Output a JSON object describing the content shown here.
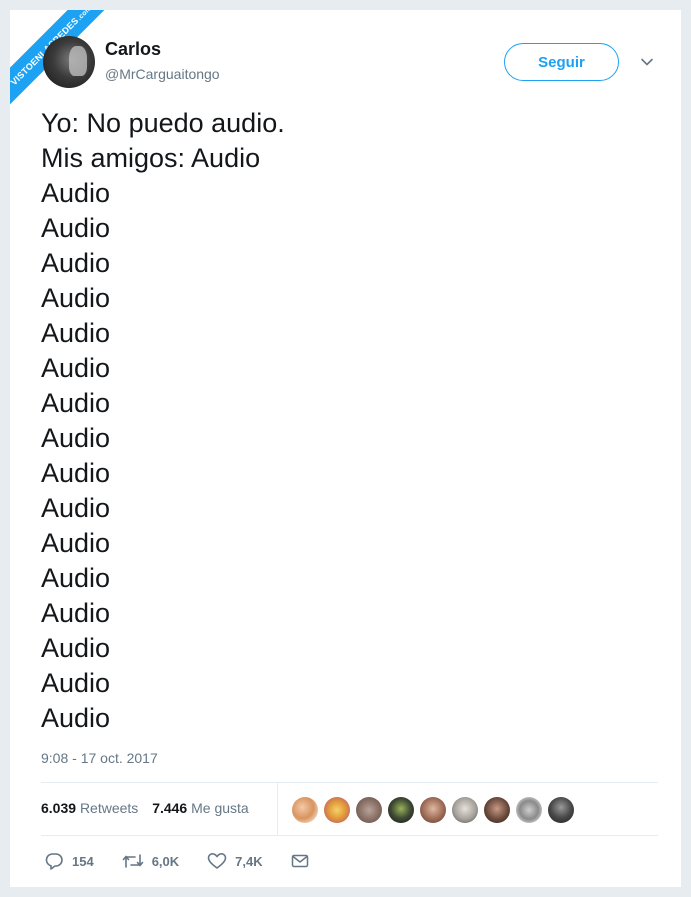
{
  "watermark": {
    "text": "VISTOENLASREDES",
    "suffix": ".com"
  },
  "user": {
    "name": "Carlos",
    "handle": "@MrCarguaitongo"
  },
  "follow_label": "Seguir",
  "tweet": {
    "lines": [
      "Yo: No puedo audio.",
      "Mis amigos: Audio",
      "Audio",
      "Audio",
      "Audio",
      "Audio",
      "Audio",
      "Audio",
      "Audio",
      "Audio",
      "Audio",
      "Audio",
      "Audio",
      "Audio",
      "Audio",
      "Audio",
      "Audio",
      "Audio"
    ]
  },
  "timestamp": "9:08 - 17 oct. 2017",
  "stats": {
    "retweets_count": "6.039",
    "retweets_label": "Retweets",
    "likes_count": "7.446",
    "likes_label": "Me gusta"
  },
  "actions": {
    "replies": "154",
    "retweets": "6,0K",
    "likes": "7,4K"
  },
  "colors": {
    "accent": "#1da1f2",
    "text": "#14171a",
    "muted": "#657786",
    "background": "#e6ecf0"
  }
}
